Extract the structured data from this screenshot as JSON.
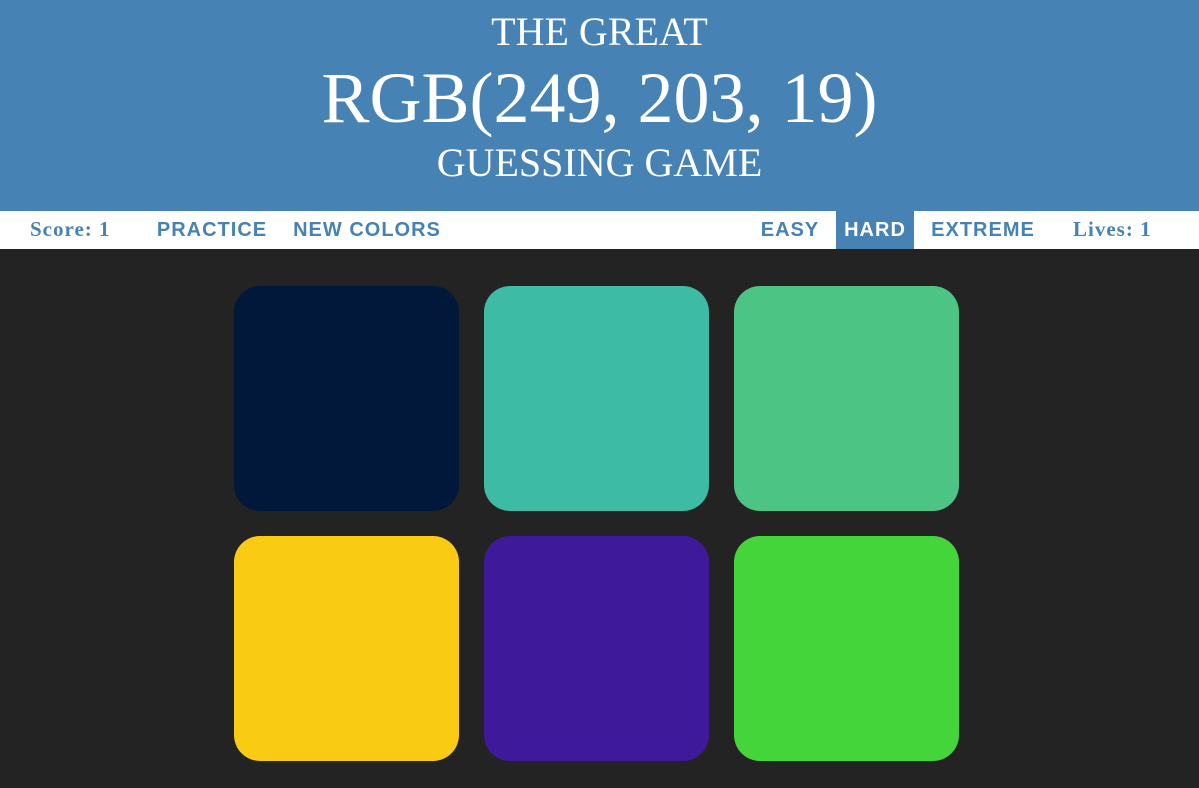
{
  "header": {
    "line1": "THE GREAT",
    "rgb": "RGB(249, 203, 19)",
    "line3": "GUESSING GAME",
    "color": "#4682b4"
  },
  "stats": {
    "score": "Score: 1",
    "lives": "Lives: 1"
  },
  "buttons": {
    "practice": "PRACTICE",
    "new_colors": "NEW COLORS",
    "easy": "EASY",
    "hard": "HARD",
    "extreme": "EXTREME",
    "selected_mode": "HARD"
  },
  "squares": [
    {
      "color": "#02183b"
    },
    {
      "color": "#3dbba5"
    },
    {
      "color": "#4cc584"
    },
    {
      "color": "#f9cb13"
    },
    {
      "color": "#3e1a9b"
    },
    {
      "color": "#44d53b"
    }
  ],
  "background": "#232323"
}
